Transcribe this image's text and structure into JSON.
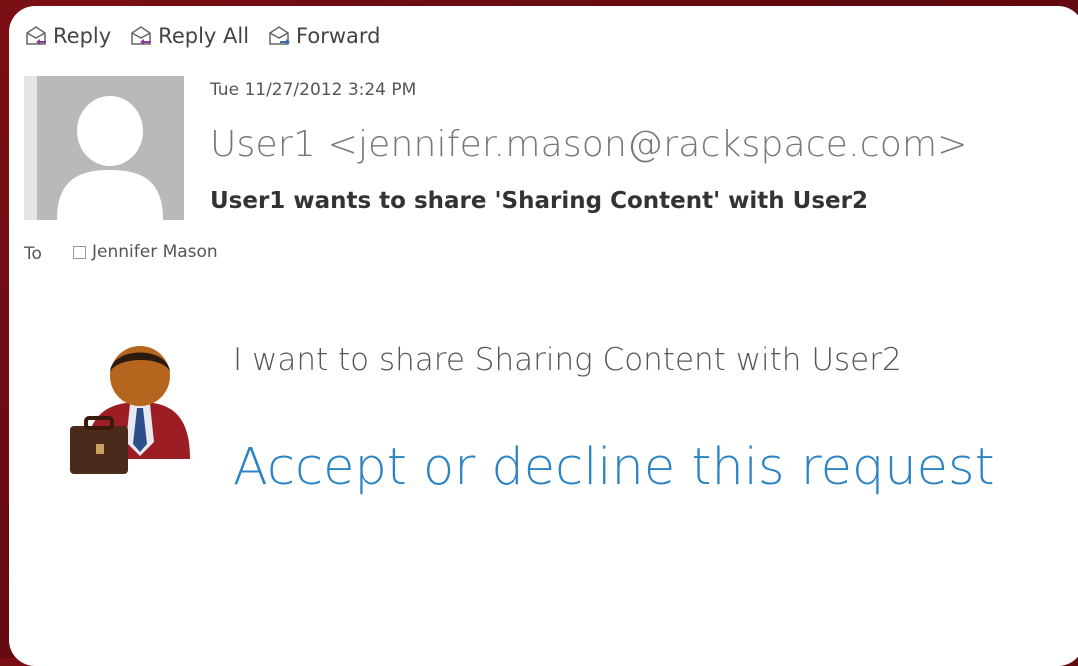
{
  "toolbar": {
    "reply_label": "Reply",
    "reply_all_label": "Reply All",
    "forward_label": "Forward",
    "reply_icon": "reply-icon",
    "reply_all_icon": "reply-all-icon",
    "forward_icon": "forward-icon"
  },
  "header": {
    "date": "Tue 11/27/2012 3:24 PM",
    "sender": "User1 <jennifer.mason@rackspace.com>",
    "subject": "User1 wants to share 'Sharing Content' with User2",
    "to_label": "To",
    "recipient": "Jennifer Mason"
  },
  "body": {
    "message": "I want to share Sharing Content with User2",
    "action_link": "Accept or decline this request"
  },
  "colors": {
    "frame": "#6d0d12",
    "link": "#2a84c4"
  }
}
